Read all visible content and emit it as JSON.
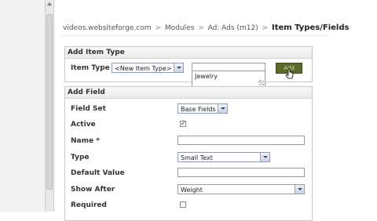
{
  "breadcrumb": {
    "items": [
      "videos.websiteforge.com",
      "Modules",
      "Ad: Ads (m12)"
    ],
    "separator": ">",
    "current": "Item Types/Fields"
  },
  "add_item_type": {
    "title": "Add Item Type",
    "item_type_label": "Item Type",
    "item_type_select": "<New Item Type>",
    "name_input_value": "",
    "suggestion": "Jewelry",
    "add_button_label": "Add"
  },
  "add_field": {
    "title": "Add Field",
    "field_set_label": "Field Set",
    "field_set_value": "Base Fields",
    "active_label": "Active",
    "active_checked": true,
    "name_label": "Name *",
    "name_value": "",
    "type_label": "Type",
    "type_value": "Small Text",
    "default_value_label": "Default Value",
    "default_value": "",
    "show_after_label": "Show After",
    "show_after_value": "Weight",
    "required_label": "Required",
    "required_checked": false
  },
  "colors": {
    "add_button_bg": "#5b6b2c",
    "panel_border": "#c9c9c9",
    "select_border": "#8f9bb0"
  }
}
